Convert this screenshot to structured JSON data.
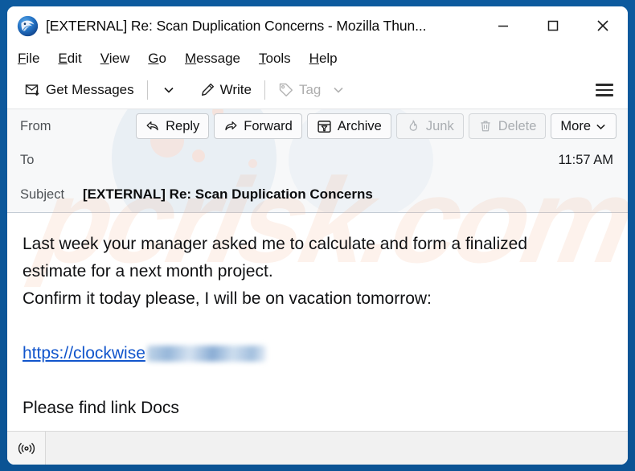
{
  "window": {
    "title": "[EXTERNAL] Re: Scan Duplication Concerns - Mozilla Thun...",
    "app_logo_name": "thunderbird-logo",
    "controls": {
      "minimize": "minimize-icon",
      "maximize": "maximize-icon",
      "close": "close-icon"
    },
    "border_color": "#0b5394"
  },
  "menu_bar": {
    "items": [
      {
        "label": "File",
        "access_key": "F"
      },
      {
        "label": "Edit",
        "access_key": "E"
      },
      {
        "label": "View",
        "access_key": "V"
      },
      {
        "label": "Go",
        "access_key": "G"
      },
      {
        "label": "Message",
        "access_key": "M"
      },
      {
        "label": "Tools",
        "access_key": "T"
      },
      {
        "label": "Help",
        "access_key": "H"
      }
    ]
  },
  "toolbar": {
    "get_messages_label": "Get Messages",
    "get_messages_icon": "envelope-download-icon",
    "get_messages_chevron": "chevron-down-icon",
    "write_label": "Write",
    "write_icon": "pencil-icon",
    "tag_label": "Tag",
    "tag_icon": "tag-icon",
    "tag_chevron": "chevron-down-icon",
    "tag_disabled": true,
    "app_menu_icon": "hamburger-menu-icon"
  },
  "message_header": {
    "from_label": "From",
    "from_value": "",
    "to_label": "To",
    "to_value": "",
    "time": "11:57 AM",
    "subject_label": "Subject",
    "subject_value": "[EXTERNAL] Re: Scan Duplication Concerns",
    "actions": [
      {
        "label": "Reply",
        "icon": "reply-arrow-icon",
        "disabled": false,
        "chevron": false
      },
      {
        "label": "Forward",
        "icon": "forward-arrow-icon",
        "disabled": false,
        "chevron": false
      },
      {
        "label": "Archive",
        "icon": "archive-box-icon",
        "disabled": false,
        "chevron": false
      },
      {
        "label": "Junk",
        "icon": "flame-icon",
        "disabled": true,
        "chevron": false
      },
      {
        "label": "Delete",
        "icon": "trash-icon",
        "disabled": true,
        "chevron": false
      },
      {
        "label": "More",
        "icon": "",
        "disabled": false,
        "chevron": true
      }
    ]
  },
  "message_body": {
    "paragraph_line_1": "Last week your manager asked me to calculate and form a finalized",
    "paragraph_line_2": "estimate for a next month project.",
    "paragraph_line_3": "Confirm it today please, I will be on vacation tomorrow:",
    "link_text": "https://clockwise",
    "link_redacted": true,
    "closing_line": "Please find link Docs",
    "link_color": "#1155cc"
  },
  "status_bar": {
    "online_icon": "broadcast-online-icon",
    "status_text": ""
  },
  "watermark": {
    "text": "pcrisk.com",
    "color": "#f4b28c"
  }
}
